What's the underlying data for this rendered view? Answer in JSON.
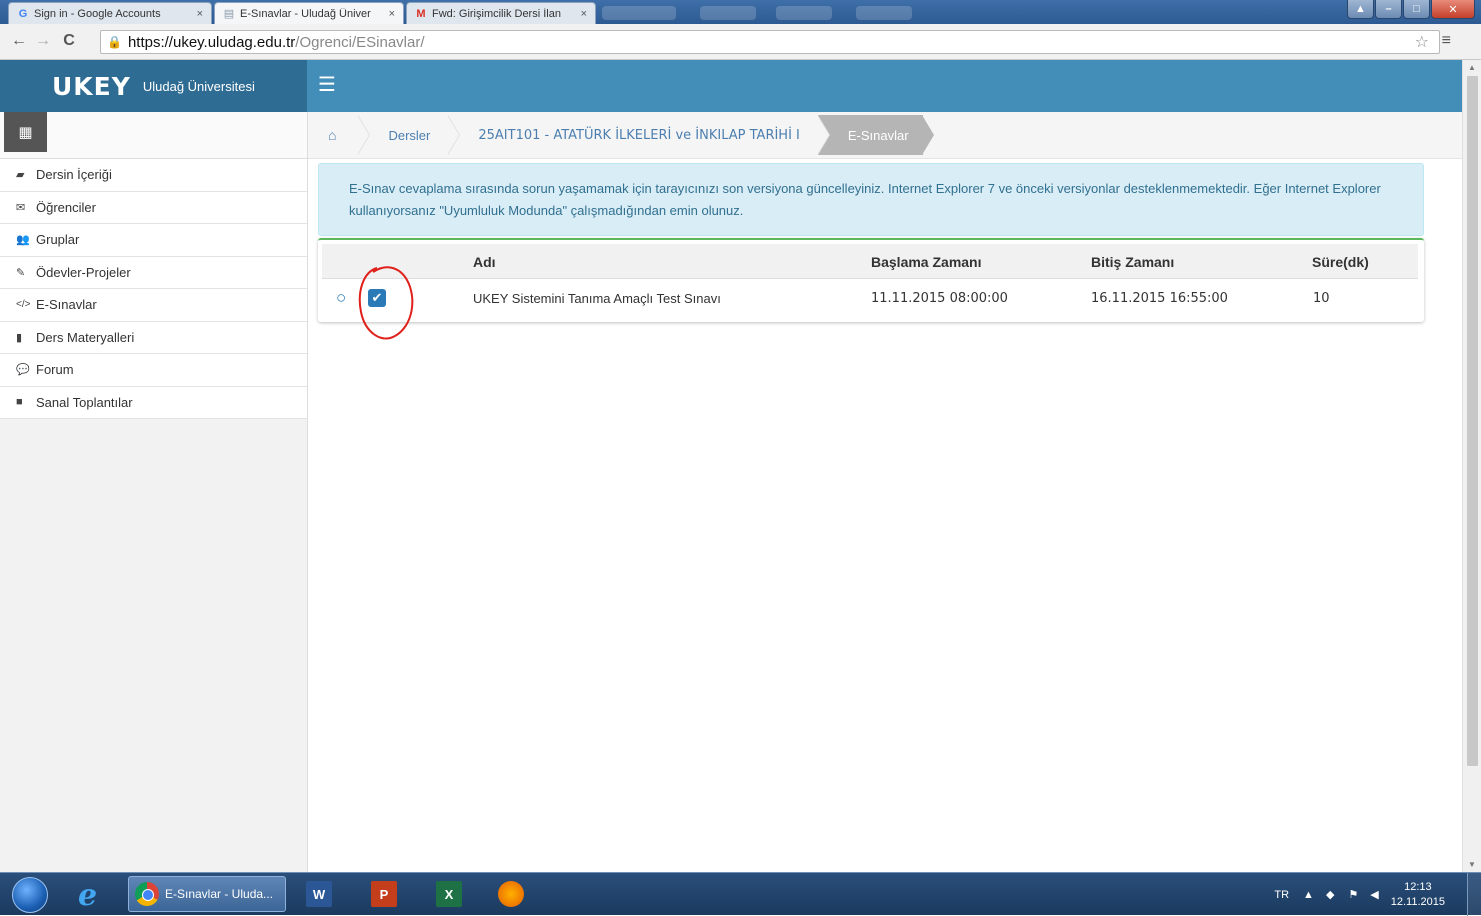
{
  "browser": {
    "tabs": [
      {
        "label": "Sign in - Google Accounts",
        "icon": "G",
        "close": "×"
      },
      {
        "label": "E-Sınavlar - Uludağ Üniver",
        "icon": "▤",
        "close": "×"
      },
      {
        "label": "Fwd: Girişimcilik Dersi İlan",
        "icon": "M",
        "close": "×"
      }
    ],
    "url_host": "https://ukey.uludag.edu.tr",
    "url_path": "/Ogrenci/ESinavlar/"
  },
  "header": {
    "logo": "UKEY",
    "university": "Uludağ Üniversitesi"
  },
  "sidebar": {
    "items": [
      {
        "label": "Dersin İçeriği",
        "icon": "folder-open-icon"
      },
      {
        "label": "Öğrenciler",
        "icon": "envelope-icon"
      },
      {
        "label": "Gruplar",
        "icon": "users-icon"
      },
      {
        "label": "Ödevler-Projeler",
        "icon": "edit-icon"
      },
      {
        "label": "E-Sınavlar",
        "icon": "code-icon"
      },
      {
        "label": "Ders Materyalleri",
        "icon": "book-icon"
      },
      {
        "label": "Forum",
        "icon": "comments-icon"
      },
      {
        "label": "Sanal Toplantılar",
        "icon": "video-camera-icon"
      }
    ]
  },
  "breadcrumb": {
    "items": [
      "Dersler",
      "25AIT101 - ATATÜRK İLKELERİ ve İNKILAP TARİHİ I"
    ],
    "current": "E-Sınavlar"
  },
  "alert": {
    "text": "E-Sınav cevaplama sırasında sorun yaşamamak için tarayıcınızı son versiyona güncelleyiniz. Internet Explorer 7 ve önceki versiyonlar desteklenmemektedir. Eğer Internet Explorer kullanıyorsanız \"Uyumluluk Modunda\" çalışmadığından emin olunuz."
  },
  "table": {
    "columns": {
      "name": "Adı",
      "start": "Başlama Zamanı",
      "end": "Bitiş Zamanı",
      "duration": "Süre(dk)"
    },
    "rows": [
      {
        "name": "UKEY Sistemini Tanıma Amaçlı Test Sınavı",
        "start": "11.11.2015 08:00:00",
        "end": "16.11.2015 16:55:00",
        "duration": "10",
        "checked": true
      }
    ]
  },
  "taskbar": {
    "active_task": "E-Sınavlar - Uluda...",
    "language": "TR",
    "time": "12:13",
    "date": "12.11.2015"
  },
  "colors": {
    "topbar": "#438eb9",
    "brand": "#2f6c94",
    "alert_bg": "#d9edf7",
    "accent": "#2a7ab8",
    "annotation": "#e0201a"
  }
}
